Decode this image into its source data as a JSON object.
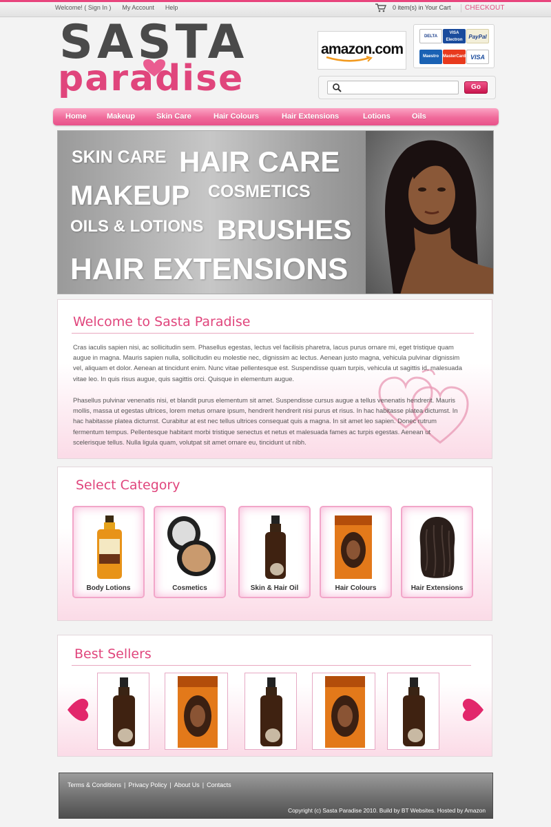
{
  "topbar": {
    "welcome": "Welcome! ( Sign In )",
    "my_account": "My Account",
    "help": "Help",
    "cart": "0 item(s) in Your Cart",
    "checkout": "CHECKOUT"
  },
  "logo": {
    "line1": "SASTA",
    "line2": "paradise"
  },
  "amazon": {
    "label": "amazon.com"
  },
  "cards": [
    {
      "name": "DELTA",
      "color": "#ffffff",
      "text": "#1b3f8b"
    },
    {
      "name": "VISA Electron",
      "color": "#1a4b9c",
      "text": "#ffffff"
    },
    {
      "name": "PayPal",
      "color": "#f3efd9",
      "text": "#1b3f8b"
    },
    {
      "name": "Maestro",
      "color": "#1a62b4",
      "text": "#ffffff"
    },
    {
      "name": "MasterCard",
      "color": "#e83a1d",
      "text": "#ffffff"
    },
    {
      "name": "VISA",
      "color": "#ffffff",
      "text": "#1a4b9c"
    }
  ],
  "search": {
    "placeholder": "",
    "button": "Go"
  },
  "nav": [
    "Home",
    "Makeup",
    "Skin Care",
    "Hair Colours",
    "Hair Extensions",
    "Lotions",
    "Oils"
  ],
  "banner": {
    "skin_care": "SKIN CARE",
    "hair_care": "HAIR CARE",
    "makeup": "MAKEUP",
    "cosmetics": "COSMETICS",
    "oils_lotions": "OILS & LOTIONS",
    "brushes": "BRUSHES",
    "hair_extensions": "HAIR EXTENSIONS"
  },
  "welcome": {
    "title": "Welcome to Sasta Paradise",
    "para1": "Cras iaculis sapien nisi, ac sollicitudin sem. Phasellus egestas, lectus vel facilisis pharetra, lacus purus ornare mi, eget tristique quam augue in magna. Mauris sapien nulla, sollicitudin eu molestie nec, dignissim ac lectus. Aenean justo magna, vehicula pulvinar dignissim vel, aliquam et dolor. Aenean at tincidunt enim. Nunc vitae pellentesque est. Suspendisse quam turpis, vehicula ut sagittis id, malesuada vitae leo. In quis risus augue, quis sagittis orci. Quisque in elementum augue.",
    "para2": "Phasellus pulvinar venenatis nisi, et blandit purus elementum sit amet. Suspendisse cursus augue a tellus venenatis hendrerit. Mauris mollis, massa ut egestas ultrices, lorem metus ornare ipsum, hendrerit hendrerit nisi purus et risus. In hac habitasse platea dictumst. In hac habitasse platea dictumst. Curabitur at est nec tellus ultrices consequat quis a magna. In sit amet leo sapien. Donec rutrum fermentum tempus. Pellentesque habitant morbi tristique senectus et netus et malesuada fames ac turpis egestas. Aenean ut scelerisque tellus. Nulla ligula quam, volutpat sit amet ornare eu, tincidunt ut nibh."
  },
  "categories": {
    "title": "Select Category",
    "items": [
      "Body Lotions",
      "Cosmetics",
      "Skin & Hair  Oil",
      "Hair Colours",
      "Hair Extensions"
    ]
  },
  "bestsellers": {
    "title": "Best Sellers"
  },
  "footer": {
    "terms": "Terms & Conditions",
    "privacy": "Privacy Policy",
    "about": "About Us",
    "contacts": "Contacts",
    "copyright": "Copyright (c) Sasta Paradise 2010. Build by BT Websites. Hosted by Amazon"
  }
}
